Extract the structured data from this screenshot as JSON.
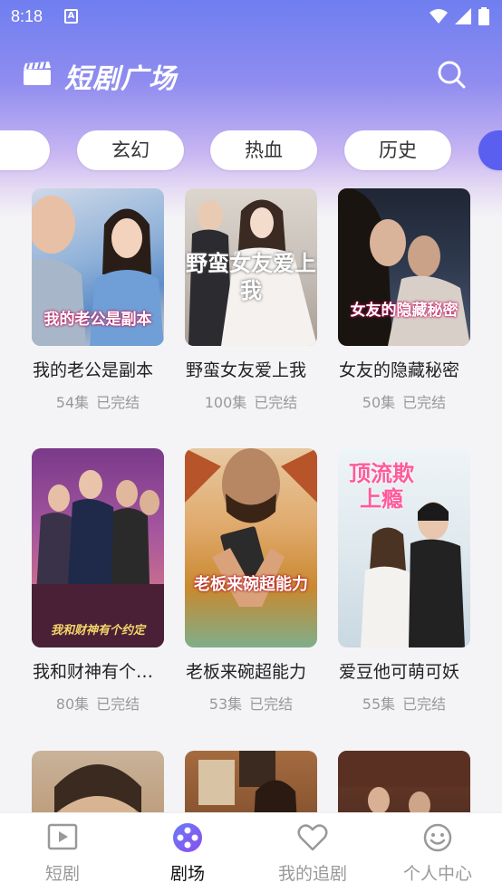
{
  "status_bar": {
    "time": "8:18",
    "notification_letter": "A"
  },
  "header": {
    "title": "短剧广场"
  },
  "tabs": [
    {
      "label": ""
    },
    {
      "label": "玄幻"
    },
    {
      "label": "热血"
    },
    {
      "label": "历史"
    },
    {
      "label": ""
    }
  ],
  "dramas": [
    {
      "title": "我的老公是副本",
      "episodes": "54集",
      "status": "已完结",
      "poster_text": "我的老公是副本"
    },
    {
      "title": "野蛮女友爱上我",
      "episodes": "100集",
      "status": "已完结",
      "poster_text": "野蛮女友爱上我"
    },
    {
      "title": "女友的隐藏秘密",
      "episodes": "50集",
      "status": "已完结",
      "poster_text": "女友的隐藏秘密"
    },
    {
      "title": "我和财神有个…",
      "episodes": "80集",
      "status": "已完结",
      "poster_text": "我和财神有个约定"
    },
    {
      "title": "老板来碗超能力",
      "episodes": "53集",
      "status": "已完结",
      "poster_text": "老板来碗超能力"
    },
    {
      "title": "爱豆他可萌可妖",
      "episodes": "55集",
      "status": "已完结",
      "poster_text": "顶流欺上瘾"
    },
    {
      "title": "",
      "episodes": "",
      "status": ""
    },
    {
      "title": "",
      "episodes": "",
      "status": ""
    },
    {
      "title": "",
      "episodes": "",
      "status": ""
    }
  ],
  "bottom_nav": [
    {
      "label": "短剧"
    },
    {
      "label": "剧场"
    },
    {
      "label": "我的追剧"
    },
    {
      "label": "个人中心"
    }
  ],
  "colors": {
    "accent": "#5a5ff0",
    "header_gradient_top": "#6f7ef0",
    "text_muted": "#999999"
  }
}
